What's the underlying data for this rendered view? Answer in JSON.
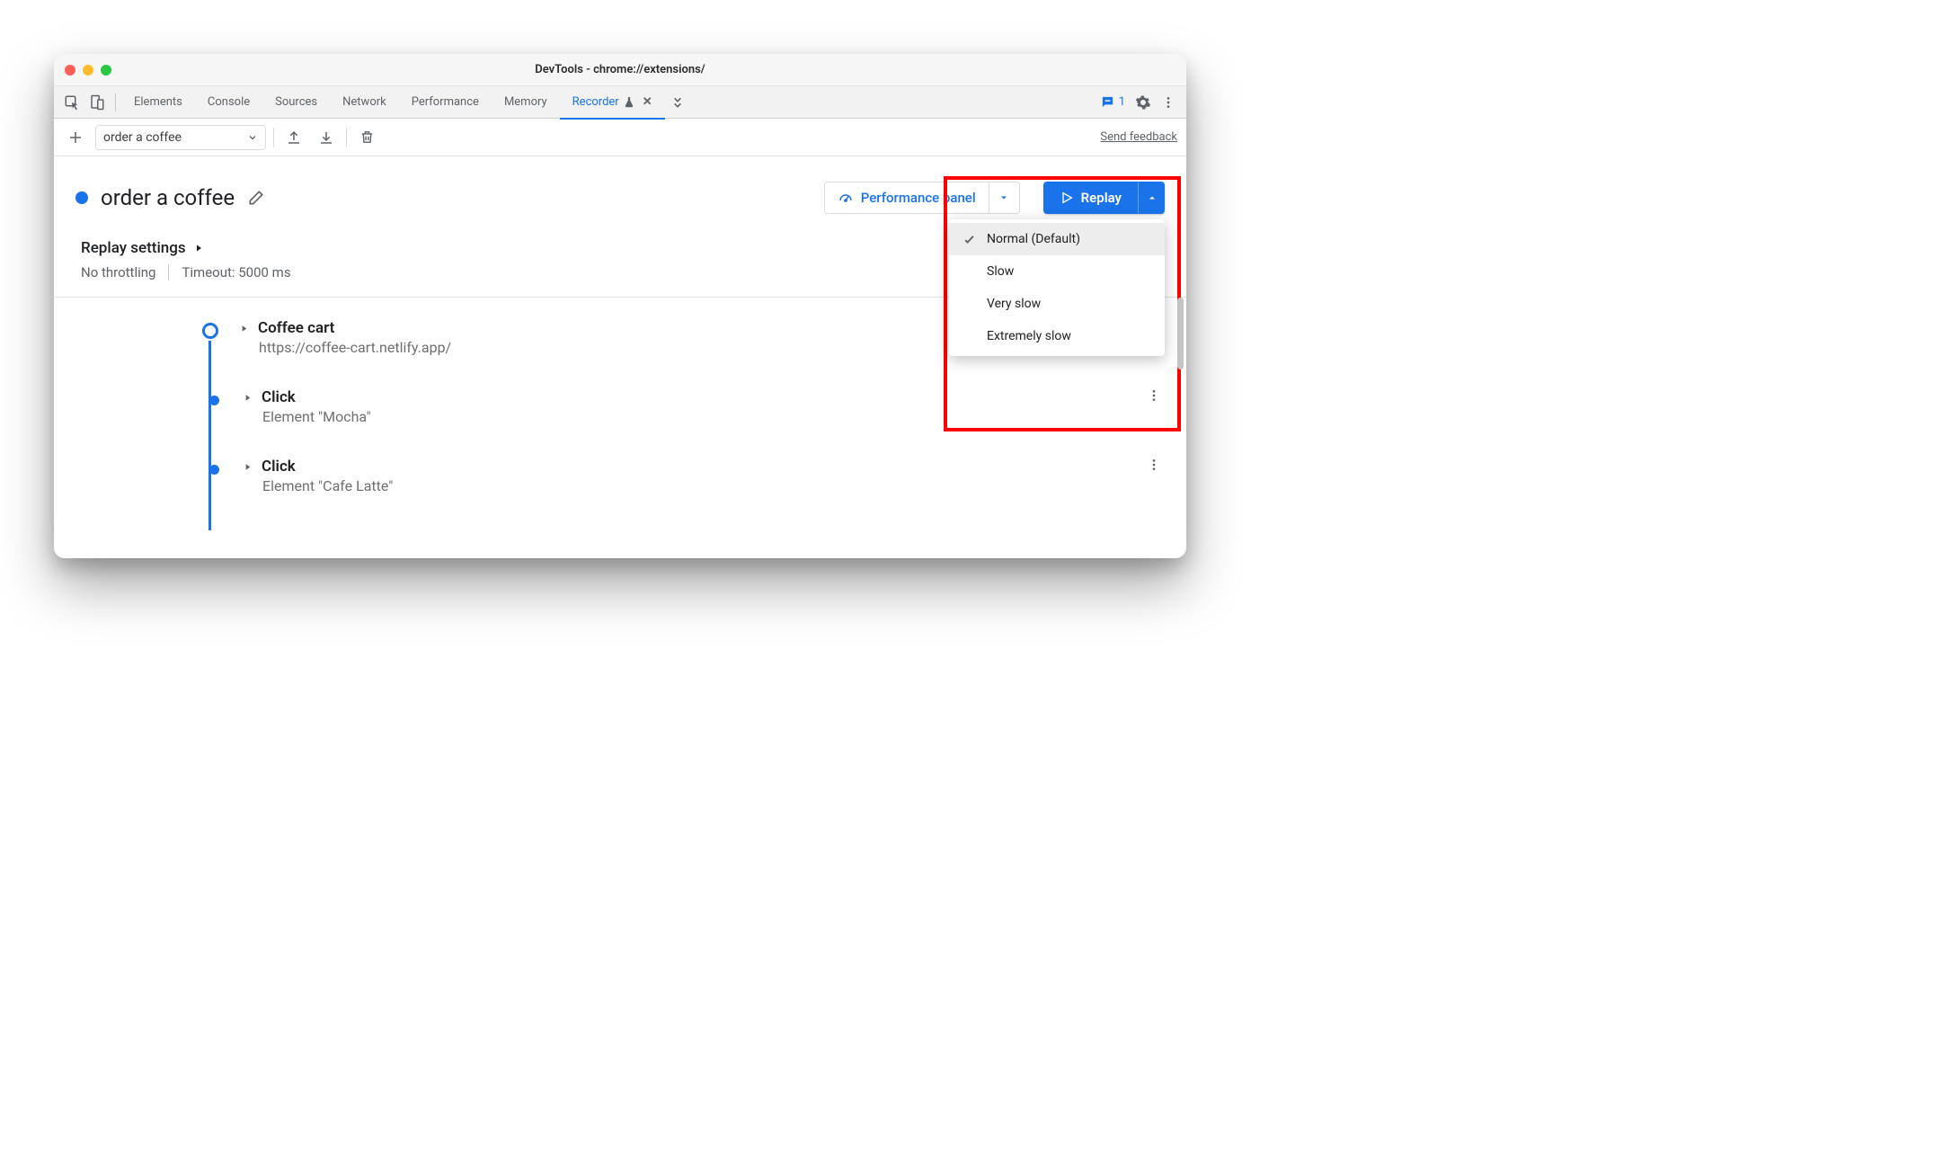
{
  "window_title": "DevTools - chrome://extensions/",
  "tabs": {
    "elements": "Elements",
    "console": "Console",
    "sources": "Sources",
    "network": "Network",
    "performance": "Performance",
    "memory": "Memory",
    "recorder": "Recorder"
  },
  "issues_count": "1",
  "toolbar": {
    "recording_name": "order a coffee",
    "feedback": "Send feedback"
  },
  "header": {
    "title": "order a coffee",
    "perf_panel": "Performance panel",
    "replay": "Replay"
  },
  "replay_menu": {
    "normal": "Normal (Default)",
    "slow": "Slow",
    "very_slow": "Very slow",
    "extremely_slow": "Extremely slow"
  },
  "settings": {
    "heading": "Replay settings",
    "throttling": "No throttling",
    "timeout": "Timeout: 5000 ms"
  },
  "steps": [
    {
      "name": "Coffee cart",
      "sub": "https://coffee-cart.netlify.app/",
      "hollow": true
    },
    {
      "name": "Click",
      "sub": "Element \"Mocha\"",
      "hollow": false
    },
    {
      "name": "Click",
      "sub": "Element \"Cafe Latte\"",
      "hollow": false
    }
  ]
}
